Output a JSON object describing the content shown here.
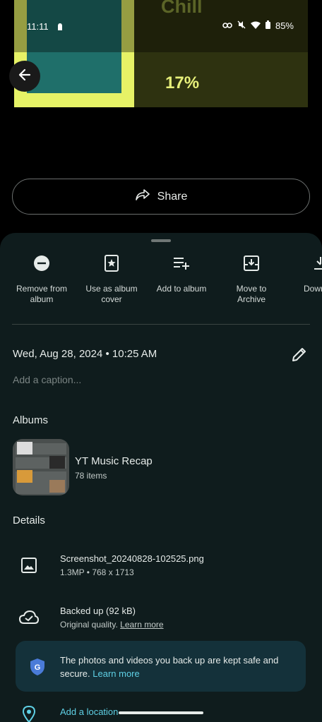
{
  "status_bar": {
    "time": "11:11",
    "battery": "85%"
  },
  "photo": {
    "title": "Chill",
    "percent": "17%"
  },
  "share": {
    "label": "Share"
  },
  "actions": [
    {
      "icon": "remove-circle-icon",
      "label_line1": "Remove from",
      "label_line2": "album"
    },
    {
      "icon": "album-cover-icon",
      "label_line1": "Use as album",
      "label_line2": "cover"
    },
    {
      "icon": "add-to-playlist-icon",
      "label_line1": "Add to album",
      "label_line2": ""
    },
    {
      "icon": "archive-icon",
      "label_line1": "Move to",
      "label_line2": "Archive"
    },
    {
      "icon": "download-icon",
      "label_line1": "Down",
      "label_line2": ""
    }
  ],
  "info": {
    "date": "Wed, Aug 28, 2024  •  10:25 AM",
    "caption_placeholder": "Add a caption..."
  },
  "albums": {
    "section_title": "Albums",
    "items": [
      {
        "name": "YT Music Recap",
        "count": "78 items"
      }
    ]
  },
  "details": {
    "section_title": "Details",
    "file": {
      "name": "Screenshot_20240828-102525.png",
      "meta": "1.3MP  •  768 x 1713"
    },
    "backup": {
      "title": "Backed up (92 kB)",
      "sub": "Original quality.",
      "link": "Learn more"
    }
  },
  "notice": {
    "text": "The photos and videos you back up are kept safe and secure.",
    "link": "Learn more"
  },
  "location": {
    "label": "Add a location"
  },
  "colors": {
    "sheet_bg": "#0f1c1d",
    "accent": "#5fd0e5",
    "notice_bg": "#14313a"
  }
}
